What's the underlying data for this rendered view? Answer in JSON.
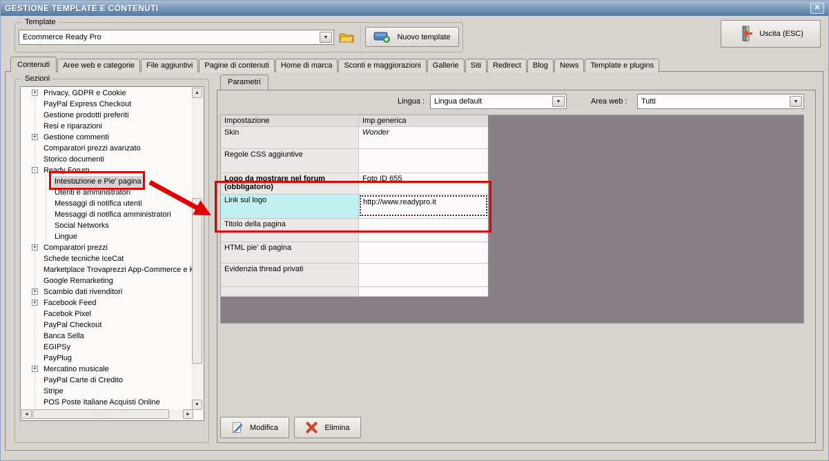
{
  "window": {
    "title": "GESTIONE TEMPLATE E CONTENUTI",
    "close_glyph": "✕"
  },
  "icons": {
    "combo_arrow": "▼",
    "scroll_up": "▲",
    "scroll_down": "▼",
    "scroll_left": "◄",
    "scroll_right": "►",
    "hscroll_grip": "::::::"
  },
  "template_box": {
    "label": "Template",
    "combo_value": "Ecommerce Ready Pro",
    "new_template_label": "Nuovo template",
    "exit_label": "Uscita (ESC)"
  },
  "tabs": {
    "active_index": 0,
    "items": [
      "Contenuti",
      "Aree web e categorie",
      "File aggiuntivi",
      "Pagine di contenuti",
      "Home di marca",
      "Sconti e maggiorazioni",
      "Gallerie",
      "Siti",
      "Redirect",
      "Blog",
      "News",
      "Template e plugins"
    ]
  },
  "sezioni": {
    "label": "Sezioni",
    "items": [
      {
        "label": "Privacy, GDPR e Cookie",
        "expand": "+"
      },
      {
        "label": "PayPal Express Checkout"
      },
      {
        "label": "Gestione prodotti preferiti"
      },
      {
        "label": "Resi e riparazioni"
      },
      {
        "label": "Gestione commenti",
        "expand": "+"
      },
      {
        "label": "Comparatori prezzi avanzato"
      },
      {
        "label": "Storico documenti"
      },
      {
        "label": "Ready Forum",
        "expand": "-"
      },
      {
        "label": "Intestazione e Pie' pagina",
        "child": true,
        "selected": true
      },
      {
        "label": "Utenti e amministratori",
        "child": true
      },
      {
        "label": "Messaggi di notifica utenti",
        "child": true
      },
      {
        "label": "Messaggi di notifica amministratori",
        "child": true
      },
      {
        "label": "Social Networks",
        "child": true
      },
      {
        "label": "Lingue",
        "child": true
      },
      {
        "label": "Comparatori prezzi",
        "expand": "+"
      },
      {
        "label": "Schede tecniche IceCat"
      },
      {
        "label": "Marketplace Trovaprezzi App-Commerce e Ki"
      },
      {
        "label": "Google Remarketing"
      },
      {
        "label": "Scambio dati rivenditori",
        "expand": "+"
      },
      {
        "label": "Facebook Feed",
        "expand": "+"
      },
      {
        "label": "Facebok Pixel"
      },
      {
        "label": "PayPal Checkout"
      },
      {
        "label": "Banca Sella"
      },
      {
        "label": "EGIPSy"
      },
      {
        "label": "PayPlug"
      },
      {
        "label": "Mercatino musicale",
        "expand": "+"
      },
      {
        "label": "PayPal Carte di Credito"
      },
      {
        "label": "Stripe"
      },
      {
        "label": "POS Poste Italiane Acquisti Online"
      }
    ]
  },
  "parametri": {
    "tab_label": "Parametri",
    "lingua_label": "Lingua :",
    "lingua_value": "Lingua default",
    "area_label": "Area web :",
    "area_value": "Tutti",
    "rows": [
      {
        "label": "Impostazione",
        "value": "Imp.generica",
        "h": 17,
        "kind": "header"
      },
      {
        "label": "Skin",
        "value": "Wonder",
        "h": 32,
        "value_style": "italic"
      },
      {
        "label": "Regole CSS aggiuntive",
        "value": "",
        "h": 35
      },
      {
        "label": "Logo da mostrare nel forum (obbligatorio)",
        "value": "Foto ID 655",
        "h": 31,
        "label_style": "bold"
      },
      {
        "label": "Link sul logo",
        "value": "http://www.readypro.it",
        "h": 35,
        "label_style": "cyan",
        "value_input": true
      },
      {
        "label": "Titolo della pagina",
        "value": "",
        "h": 34
      },
      {
        "label": "HTML pie' di pagina",
        "value": "",
        "h": 31
      },
      {
        "label": "Evidenzia thread privati",
        "value": "",
        "h": 34
      },
      {
        "label": "",
        "value": "",
        "h": 14
      }
    ],
    "modifica_label": "Modifica",
    "elimina_label": "Elimina"
  },
  "colors": {
    "annotation_red": "#e00202",
    "highlight_cyan": "#c1f0f1",
    "titlebar_blue": "#53799f",
    "grid_gray": "#868086"
  }
}
